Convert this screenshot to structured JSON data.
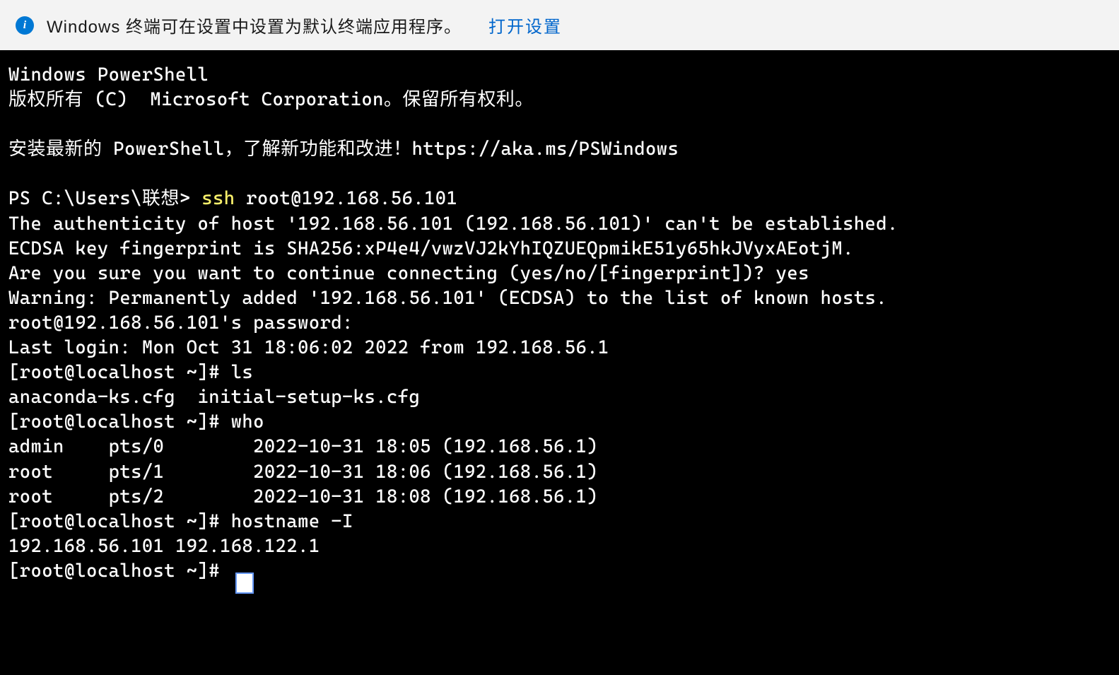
{
  "infobar": {
    "icon_name": "info-icon",
    "message": "Windows 终端可在设置中设置为默认终端应用程序。",
    "link_text": "打开设置"
  },
  "terminal": {
    "header1": "Windows PowerShell",
    "header2": "版权所有 (C)  Microsoft Corporation。保留所有权利。",
    "install_msg": "安装最新的 PowerShell，了解新功能和改进！https://aka.ms/PSWindows",
    "ps_prompt": "PS C:\\Users\\联想> ",
    "ssh_cmd_keyword": "ssh",
    "ssh_cmd_args": " root@192.168.56.101",
    "authenticity": "The authenticity of host '192.168.56.101 (192.168.56.101)' can't be established.",
    "fingerprint": "ECDSA key fingerprint is SHA256:xP4e4/vwzVJ2kYhIQZUEQpmikE51y65hkJVyxAEotjM.",
    "confirm_prompt": "Are you sure you want to continue connecting (yes/no/[fingerprint])? yes",
    "warning": "Warning: Permanently added '192.168.56.101' (ECDSA) to the list of known hosts.",
    "password_prompt": "root@192.168.56.101's password:",
    "last_login": "Last login: Mon Oct 31 18:06:02 2022 from 192.168.56.1",
    "shell_prompt": "[root@localhost ~]# ",
    "cmd_ls": "ls",
    "ls_output": "anaconda-ks.cfg  initial-setup-ks.cfg",
    "cmd_who": "who",
    "who_output1": "admin    pts/0        2022-10-31 18:05 (192.168.56.1)",
    "who_output2": "root     pts/1        2022-10-31 18:06 (192.168.56.1)",
    "who_output3": "root     pts/2        2022-10-31 18:08 (192.168.56.1)",
    "cmd_hostname": "hostname -I",
    "hostname_output": "192.168.56.101 192.168.122.1",
    "final_prompt": "[root@localhost ~]# "
  }
}
